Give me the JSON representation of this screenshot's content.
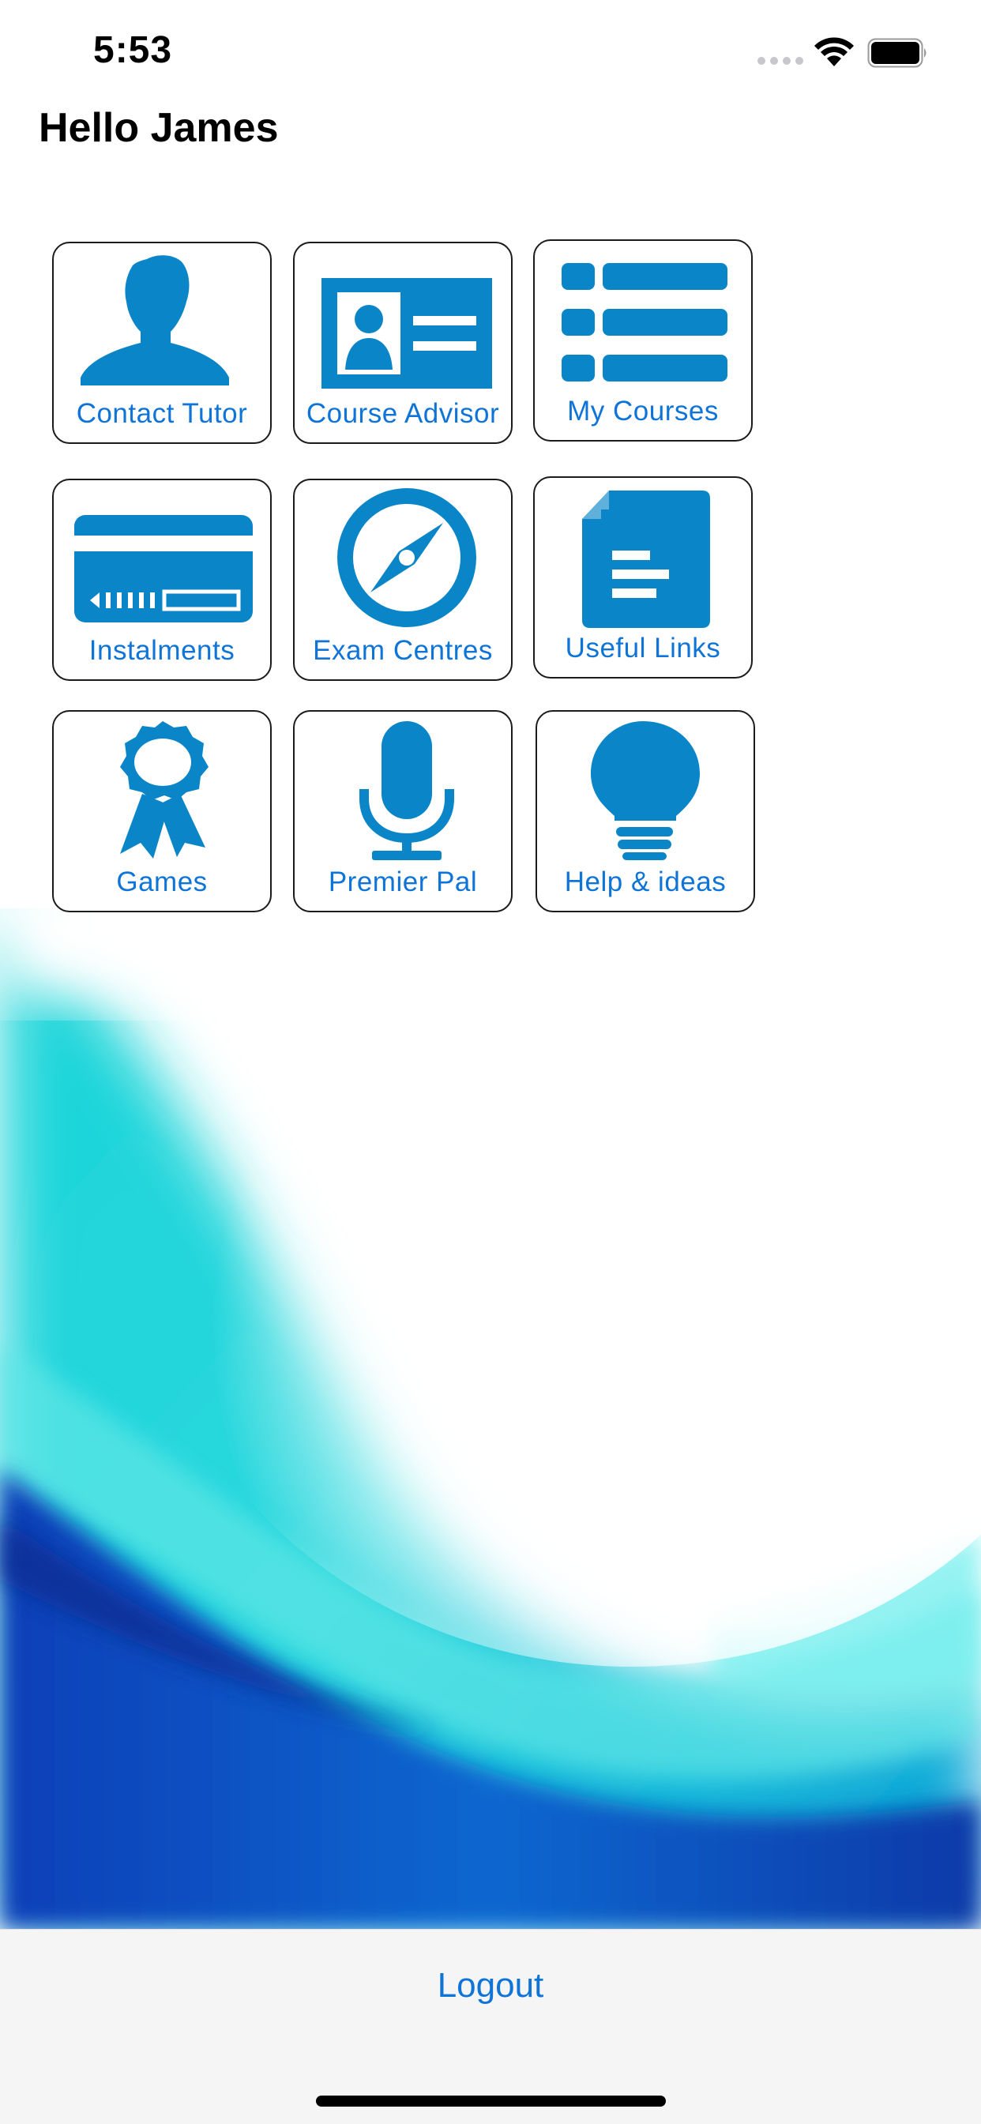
{
  "status_bar": {
    "time": "5:53"
  },
  "header": {
    "greeting": "Hello James"
  },
  "menu": {
    "items": [
      {
        "label": "Contact Tutor",
        "icon": "person-icon"
      },
      {
        "label": "Course Advisor",
        "icon": "id-card-icon"
      },
      {
        "label": "My Courses",
        "icon": "list-icon"
      },
      {
        "label": "Instalments",
        "icon": "credit-card-icon"
      },
      {
        "label": "Exam Centres",
        "icon": "compass-icon"
      },
      {
        "label": "Useful Links",
        "icon": "document-icon"
      },
      {
        "label": "Games",
        "icon": "award-ribbon-icon"
      },
      {
        "label": "Premier Pal",
        "icon": "microphone-icon"
      },
      {
        "label": "Help & ideas",
        "icon": "lightbulb-icon"
      }
    ]
  },
  "footer": {
    "logout_label": "Logout"
  },
  "colors": {
    "icon_blue": "#0a86c8",
    "label_blue": "#0f74d8",
    "tile_border": "#1b1b1b"
  }
}
